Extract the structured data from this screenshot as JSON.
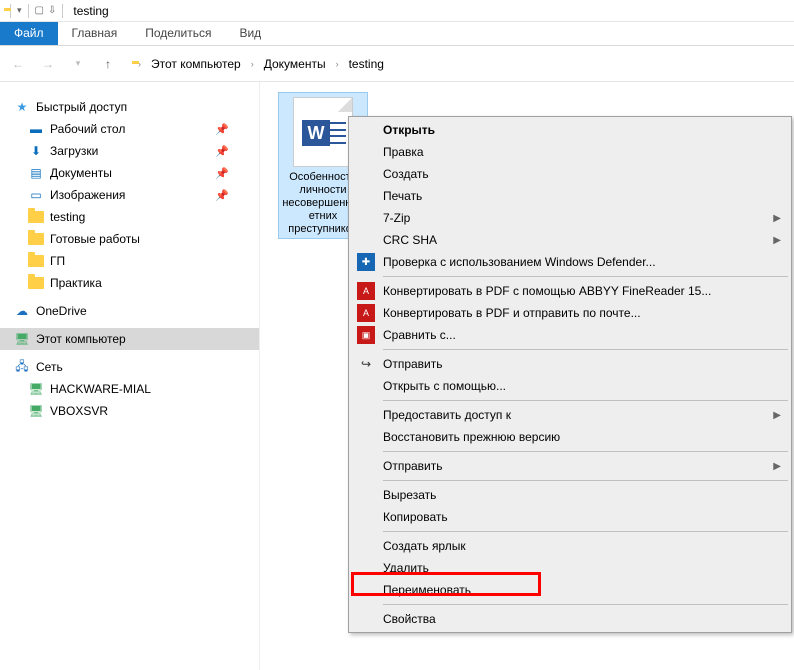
{
  "window": {
    "title": "testing"
  },
  "ribbon": {
    "file": "Файл",
    "home": "Главная",
    "share": "Поделиться",
    "view": "Вид"
  },
  "breadcrumb": {
    "root": "Этот компьютер",
    "docs": "Документы",
    "folder": "testing"
  },
  "sidebar": {
    "quick": "Быстрый доступ",
    "desktop": "Рабочий стол",
    "downloads": "Загрузки",
    "documents": "Документы",
    "pictures": "Изображения",
    "testing": "testing",
    "ready": "Готовые работы",
    "gp": "ГП",
    "practice": "Практика",
    "onedrive": "OneDrive",
    "thispc": "Этот компьютер",
    "network": "Сеть",
    "hackware": "HACKWARE-MIAL",
    "vbox": "VBOXSVR"
  },
  "file": {
    "name": "Особенности личности несовершеннолетних преступников"
  },
  "ctx": {
    "open": "Открыть",
    "edit": "Правка",
    "create": "Создать",
    "print": "Печать",
    "sevenzip": "7-Zip",
    "crcsha": "CRC SHA",
    "defender": "Проверка с использованием Windows Defender...",
    "abbyy1": "Конвертировать в PDF с помощью ABBYY FineReader 15...",
    "abbyy2": "Конвертировать в PDF и отправить по почте...",
    "compare": "Сравнить с...",
    "send": "Отправить",
    "openwith": "Открыть с помощью...",
    "grantaccess": "Предоставить доступ к",
    "restore": "Восстановить прежнюю версию",
    "sendto": "Отправить",
    "cut": "Вырезать",
    "copy": "Копировать",
    "shortcut": "Создать ярлык",
    "delete": "Удалить",
    "rename": "Переименовать",
    "props": "Свойства"
  }
}
